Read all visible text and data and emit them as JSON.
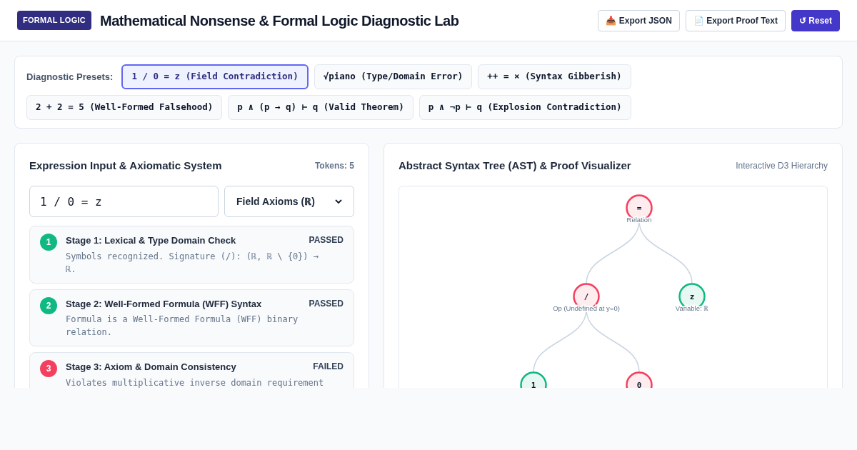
{
  "header": {
    "badge": "FORMAL LOGIC",
    "title": "Mathematical Nonsense & Formal Logic Diagnostic Lab",
    "actions": [
      {
        "icon": "📥",
        "label": "Export JSON",
        "kind": "outline"
      },
      {
        "icon": "📄",
        "label": "Export Proof Text",
        "kind": "outline"
      },
      {
        "icon": "↺",
        "label": "Reset",
        "kind": "primary"
      }
    ]
  },
  "presets": {
    "label": "Diagnostic Presets:",
    "items": [
      {
        "label": "1 / 0 = z (Field Contradiction)",
        "selected": true
      },
      {
        "label": "√piano (Type/Domain Error)",
        "selected": false
      },
      {
        "label": "++ = × (Syntax Gibberish)",
        "selected": false
      },
      {
        "label": "2 + 2 = 5 (Well-Formed Falsehood)",
        "selected": false
      },
      {
        "label": "p ∧ (p → q) ⊢ q (Valid Theorem)",
        "selected": false
      },
      {
        "label": "p ∧ ¬p ⊢ q (Explosion Contradiction)",
        "selected": false
      }
    ]
  },
  "input_panel": {
    "title": "Expression Input & Axiomatic System",
    "tokens": "Tokens: 5",
    "expression": "1 / 0 = z",
    "axiom_system": "Field Axioms (ℝ)",
    "stages": [
      {
        "number": "1",
        "title": "Stage 1: Lexical & Type Domain Check",
        "status": "PASSED",
        "color": "#10b981",
        "description": "Symbols recognized. Signature (/): (ℝ, ℝ \\ {0}) → ℝ."
      },
      {
        "number": "2",
        "title": "Stage 2: Well-Formed Formula (WFF) Syntax",
        "status": "PASSED",
        "color": "#10b981",
        "description": "Formula is a Well-Formed Formula (WFF) binary relation."
      },
      {
        "number": "3",
        "title": "Stage 3: Axiom & Domain Consistency",
        "status": "FAILED",
        "color": "#f43f5e",
        "description": "Violates multiplicative inverse domain requirement"
      }
    ]
  },
  "ast_panel": {
    "title": "Abstract Syntax Tree (AST) & Proof Visualizer",
    "subtitle": "Interactive D3 Hierarchy",
    "tree": {
      "symbol": "=",
      "label": "Relation",
      "color": "#f43f5e",
      "children": [
        {
          "symbol": "/",
          "label": "Op (Undefined at y=0)",
          "color": "#f43f5e",
          "children": [
            {
              "symbol": "1",
              "color": "#10b981"
            },
            {
              "symbol": "0",
              "color": "#f43f5e"
            }
          ]
        },
        {
          "symbol": "z",
          "label": "Variable: ℝ",
          "color": "#10b981"
        }
      ]
    }
  }
}
